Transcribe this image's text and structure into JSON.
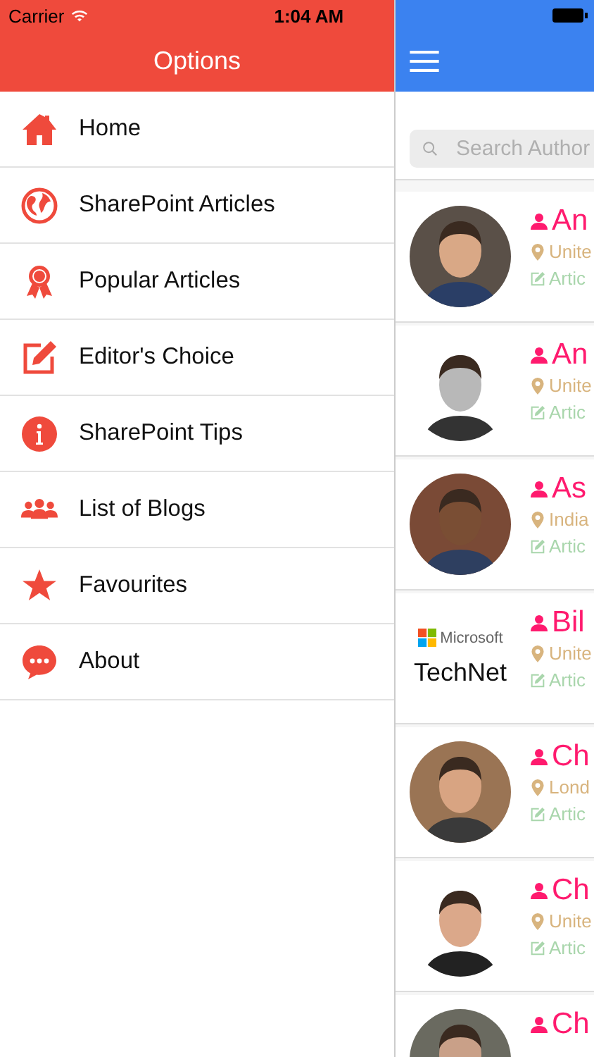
{
  "status_bar": {
    "carrier": "Carrier",
    "time": "1:04 AM"
  },
  "drawer": {
    "title": "Options",
    "items": [
      {
        "label": "Home"
      },
      {
        "label": "SharePoint Articles"
      },
      {
        "label": "Popular Articles"
      },
      {
        "label": "Editor's Choice"
      },
      {
        "label": "SharePoint Tips"
      },
      {
        "label": "List of Blogs"
      },
      {
        "label": "Favourites"
      },
      {
        "label": "About"
      }
    ]
  },
  "main": {
    "search": {
      "placeholder": "Search Author"
    },
    "authors": [
      {
        "name": "An",
        "location": "Unite",
        "articles": "Artic"
      },
      {
        "name": "An",
        "location": "Unite",
        "articles": "Artic"
      },
      {
        "name": "As",
        "location": "India",
        "articles": "Artic"
      },
      {
        "avatar": {
          "kind": "logo",
          "texts": [
            "Microsoft",
            "TechNet"
          ]
        },
        "name": "Bil",
        "location": "Unite",
        "articles": "Artic"
      },
      {
        "name": "Ch",
        "location": "Lond",
        "articles": "Artic"
      },
      {
        "name": "Ch",
        "location": "Unite",
        "articles": "Artic"
      },
      {
        "name": "Ch"
      }
    ]
  }
}
